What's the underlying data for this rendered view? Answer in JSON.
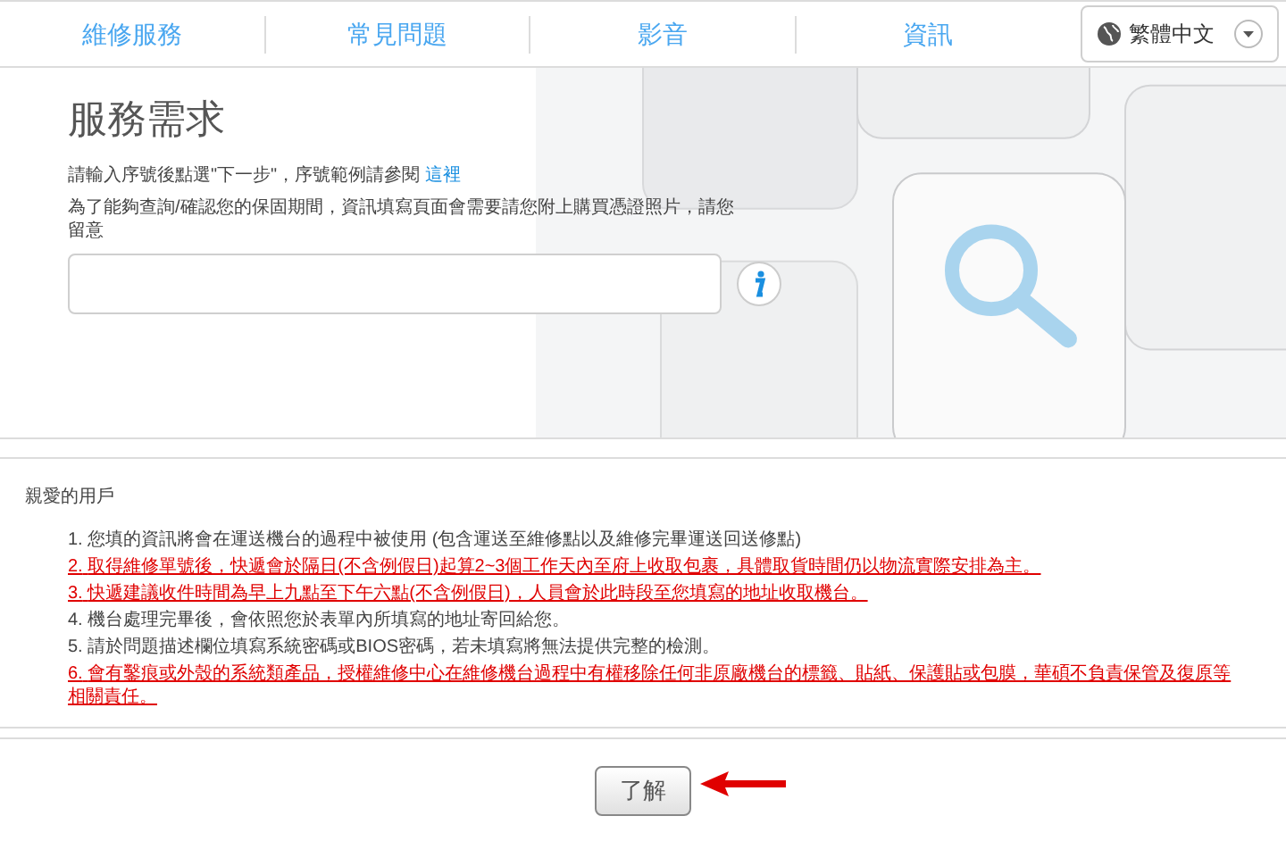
{
  "nav": {
    "tabs": [
      {
        "label": "維修服務"
      },
      {
        "label": "常見問題"
      },
      {
        "label": "影音"
      },
      {
        "label": "資訊"
      }
    ],
    "language": "繁體中文"
  },
  "service": {
    "title": "服務需求",
    "instruction": "請輸入序號後點選\"下一步\"，序號範例請參閱",
    "link": "這裡",
    "note": "為了能夠查詢/確認您的保固期間，資訊填寫頁面會需要請您附上購買憑證照片，請您留意"
  },
  "notice": {
    "greeting": "親愛的用戶",
    "items": [
      {
        "number": "1.",
        "text": "您填的資訊將會在運送機台的過程中被使用 (包含運送至維修點以及維修完畢運送回送修點)",
        "important": false
      },
      {
        "number": "2.",
        "text": "取得維修單號後，快遞會於隔日(不含例假日)起算2~3個工作天內至府上收取包裹，具體取貨時間仍以物流實際安排為主。",
        "important": true
      },
      {
        "number": "3.",
        "text": "快遞建議收件時間為早上九點至下午六點(不含例假日)，人員會於此時段至您填寫的地址收取機台。",
        "important": true
      },
      {
        "number": "4.",
        "text": "機台處理完畢後，會依照您於表單內所填寫的地址寄回給您。",
        "important": false
      },
      {
        "number": "5.",
        "text": "請於問題描述欄位填寫系統密碼或BIOS密碼，若未填寫將無法提供完整的檢測。",
        "important": false
      },
      {
        "number": "6.",
        "text": "會有鑿痕或外殼的系統類產品，授權維修中心在維修機台過程中有權移除任何非原廠機台的標籤、貼紙、保護貼或包膜，華碩不負責保管及復原等相關責任。",
        "important": true
      }
    ]
  },
  "confirm_button": "了解"
}
